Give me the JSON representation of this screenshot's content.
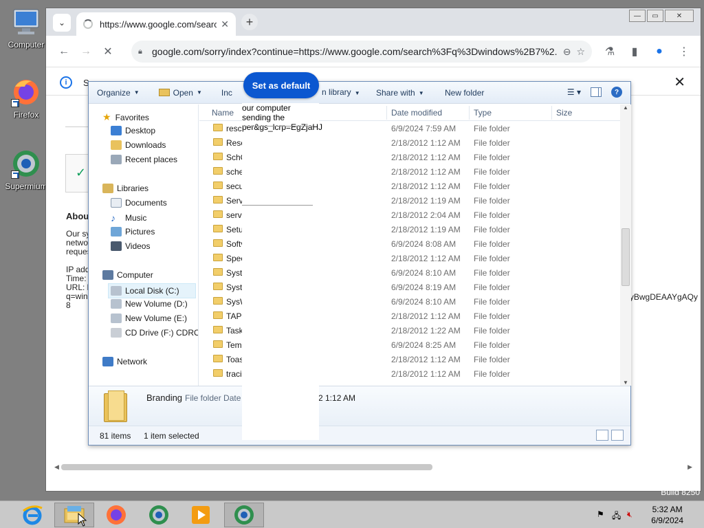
{
  "desktop": {
    "icons": [
      {
        "label": "Computer"
      },
      {
        "label": "Firefox"
      },
      {
        "label": "Supermium"
      }
    ],
    "build": "Build 8250"
  },
  "browser": {
    "tab_title": "https://www.google.com/search",
    "url": "google.com/sorry/index?continue=https://www.google.com/search%3Fq%3Dwindows%2B7%2...",
    "infobar_letter": "S",
    "set_default_label": "Set as default",
    "page": {
      "about_title": "About",
      "para_lines": [
        "Our sy",
        "netwo",
        "reques"
      ],
      "mid_lines": [
        "our computer",
        "sending the"
      ],
      "ip_lines": [
        "IP add",
        "Time:",
        "URL: h",
        "q=win",
        "8"
      ],
      "query_fragment": "per&gs_lcrp=EgZjaHJ",
      "right_fragment": "yBwgDEAAYgAQy"
    }
  },
  "explorer": {
    "toolbar": {
      "organize": "Organize",
      "open": "Open",
      "include": "Inc",
      "library": "n library",
      "share": "Share with",
      "new_folder": "New folder"
    },
    "nav": {
      "favorites": "Favorites",
      "desktop": "Desktop",
      "downloads": "Downloads",
      "recent": "Recent places",
      "libraries": "Libraries",
      "documents": "Documents",
      "music": "Music",
      "pictures": "Pictures",
      "videos": "Videos",
      "computer": "Computer",
      "local_disk": "Local Disk (C:)",
      "vol_d": "New Volume (D:)",
      "vol_e": "New Volume (E:)",
      "cd": "CD Drive (F:) CDROM",
      "network": "Network"
    },
    "columns": {
      "name": "Name",
      "date": "Date modified",
      "type": "Type",
      "size": "Size"
    },
    "rows": [
      {
        "name": "resca",
        "date": "6/9/2024 7:59 AM",
        "type": "File folder"
      },
      {
        "name": "Reso",
        "date": "2/18/2012 1:12 AM",
        "type": "File folder"
      },
      {
        "name": "SchC",
        "date": "2/18/2012 1:12 AM",
        "type": "File folder"
      },
      {
        "name": "sche",
        "date": "2/18/2012 1:12 AM",
        "type": "File folder"
      },
      {
        "name": "secu",
        "date": "2/18/2012 1:12 AM",
        "type": "File folder"
      },
      {
        "name": "Servi",
        "date": "2/18/2012 1:19 AM",
        "type": "File folder"
      },
      {
        "name": "servi",
        "date": "2/18/2012 2:04 AM",
        "type": "File folder"
      },
      {
        "name": "Setu",
        "date": "2/18/2012 1:19 AM",
        "type": "File folder"
      },
      {
        "name": "Softv",
        "date": "6/9/2024 8:08 AM",
        "type": "File folder"
      },
      {
        "name": "Spee",
        "date": "2/18/2012 1:12 AM",
        "type": "File folder"
      },
      {
        "name": "Syste",
        "date": "6/9/2024 8:10 AM",
        "type": "File folder"
      },
      {
        "name": "Syste",
        "date": "6/9/2024 8:19 AM",
        "type": "File folder"
      },
      {
        "name": "SysW",
        "date": "6/9/2024 8:10 AM",
        "type": "File folder"
      },
      {
        "name": "TAPI",
        "date": "2/18/2012 1:12 AM",
        "type": "File folder"
      },
      {
        "name": "Task",
        "date": "2/18/2012 1:22 AM",
        "type": "File folder"
      },
      {
        "name": "Tem",
        "date": "6/9/2024 8:25 AM",
        "type": "File folder"
      },
      {
        "name": "Toas",
        "date": "2/18/2012 1:12 AM",
        "type": "File folder"
      },
      {
        "name": "traci",
        "date": "2/18/2012 1:12 AM",
        "type": "File folder"
      }
    ],
    "details": {
      "name": "Branding",
      "sub": "File folder  Date",
      "time": "2 1:12 AM"
    },
    "status": {
      "count": "81 items",
      "selected": "1 item selected"
    }
  },
  "taskbar": {
    "time": "5:32 AM",
    "date": "6/9/2024"
  }
}
